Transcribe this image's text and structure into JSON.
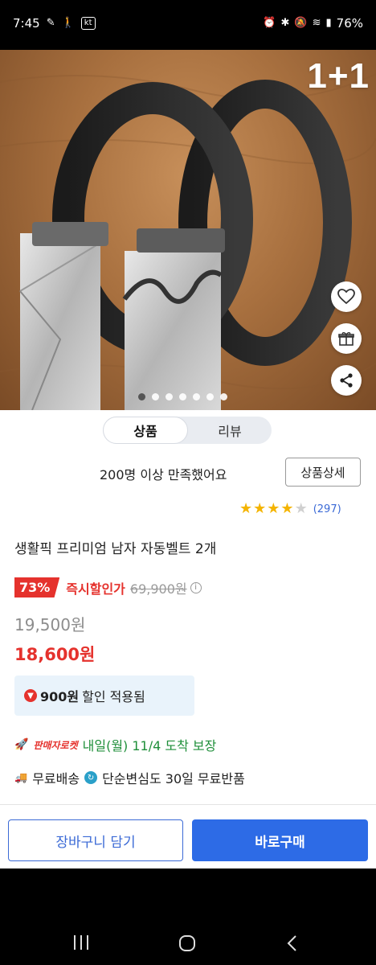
{
  "status_bar": {
    "time": "7:45",
    "carrier": "kt",
    "battery": "76%"
  },
  "hero": {
    "promo": "1+1",
    "slide_count": 7,
    "active_slide": 1
  },
  "tabs": [
    {
      "label": "상품"
    },
    {
      "label": "리뷰"
    }
  ],
  "satisfaction": {
    "text": "200명 이상 만족했어요",
    "detail_button": "상품상세"
  },
  "rating": {
    "stars": 4,
    "max": 5,
    "review_count": "(297)"
  },
  "product": {
    "title": "생활픽 프리미엄 남자 자동벨트 2개"
  },
  "pricing": {
    "discount": "73%",
    "instant_label": "즉시할인가",
    "original_price": "69,900원",
    "price_before_coupon": "19,500원",
    "final_price": "18,600원"
  },
  "coupon": {
    "amount": "900원",
    "text": "할인 적용됨"
  },
  "delivery": {
    "rocket_label": "판매자로켓",
    "arrival": "내일(월) 11/4 도착 보장",
    "free_shipping": "무료배송",
    "return_policy": "단순변심도 30일 무료반품"
  },
  "actions": {
    "cart": "장바구니 담기",
    "buy": "바로구매"
  },
  "colors": {
    "accent_blue": "#2d6be6",
    "discount_red": "#e5322d",
    "arrival_green": "#1f8f3a",
    "star_yellow": "#f4b400"
  }
}
